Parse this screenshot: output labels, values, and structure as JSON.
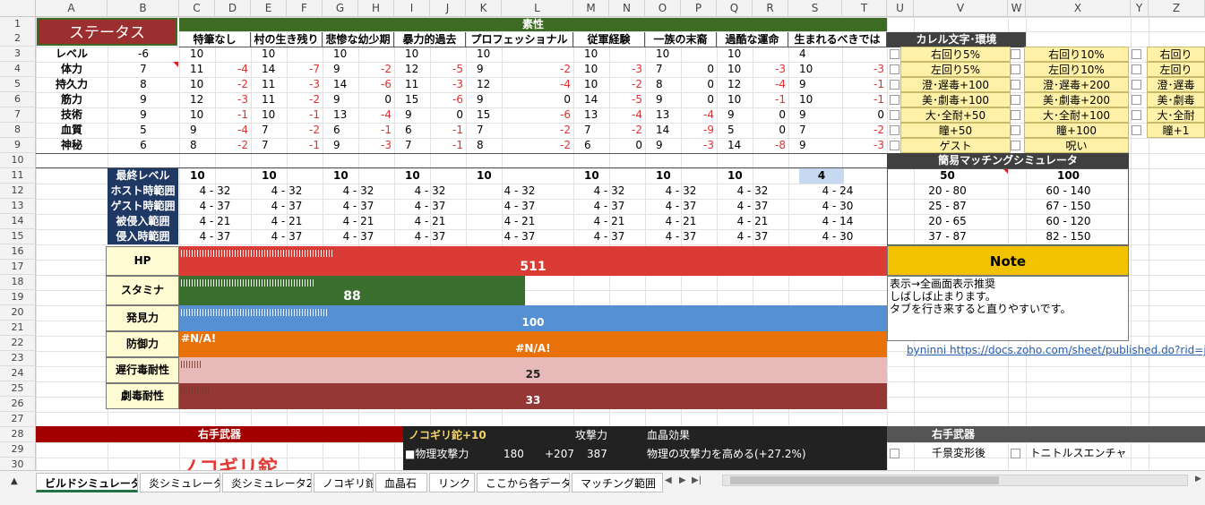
{
  "columns": [
    "A",
    "B",
    "C",
    "D",
    "E",
    "F",
    "G",
    "H",
    "I",
    "J",
    "K",
    "L",
    "M",
    "N",
    "O",
    "P",
    "Q",
    "R",
    "S",
    "T",
    "U",
    "V",
    "W",
    "X",
    "Y",
    "Z"
  ],
  "rows": [
    "1",
    "2",
    "3",
    "4",
    "5",
    "6",
    "7",
    "8",
    "9",
    "10",
    "11",
    "12",
    "13",
    "14",
    "15",
    "16",
    "17",
    "18",
    "19",
    "20",
    "21",
    "22",
    "23",
    "24",
    "25",
    "26",
    "27",
    "28",
    "29",
    "30"
  ],
  "status_title": "ステータス",
  "attr_header": "素性",
  "origins": [
    "特筆なし",
    "村の生き残り",
    "悲惨な幼少期",
    "暴力的過去",
    "プロフェッショナル",
    "従軍経験",
    "一族の末裔",
    "過酷な運命",
    "生まれるべきでは"
  ],
  "stats": [
    {
      "name": "レベル",
      "value": "-6",
      "cells": [
        [
          "10",
          ""
        ],
        [
          "10",
          ""
        ],
        [
          "10",
          ""
        ],
        [
          "10",
          ""
        ],
        [
          "10",
          ""
        ],
        [
          "10",
          ""
        ],
        [
          "10",
          ""
        ],
        [
          "10",
          ""
        ],
        [
          "4",
          ""
        ]
      ]
    },
    {
      "name": "体力",
      "value": "7",
      "cells": [
        [
          "11",
          "-4"
        ],
        [
          "14",
          "-7"
        ],
        [
          "9",
          "-2"
        ],
        [
          "12",
          "-5"
        ],
        [
          "9",
          "-2"
        ],
        [
          "10",
          "-3"
        ],
        [
          "7",
          "0"
        ],
        [
          "10",
          "-3"
        ],
        [
          "10",
          "-3"
        ]
      ]
    },
    {
      "name": "持久力",
      "value": "8",
      "cells": [
        [
          "10",
          "-2"
        ],
        [
          "11",
          "-3"
        ],
        [
          "14",
          "-6"
        ],
        [
          "11",
          "-3"
        ],
        [
          "12",
          "-4"
        ],
        [
          "10",
          "-2"
        ],
        [
          "8",
          "0"
        ],
        [
          "12",
          "-4"
        ],
        [
          "9",
          "-1"
        ]
      ]
    },
    {
      "name": "筋力",
      "value": "9",
      "cells": [
        [
          "12",
          "-3"
        ],
        [
          "11",
          "-2"
        ],
        [
          "9",
          "0"
        ],
        [
          "15",
          "-6"
        ],
        [
          "9",
          "0"
        ],
        [
          "14",
          "-5"
        ],
        [
          "9",
          "0"
        ],
        [
          "10",
          "-1"
        ],
        [
          "10",
          "-1"
        ]
      ]
    },
    {
      "name": "技術",
      "value": "9",
      "cells": [
        [
          "10",
          "-1"
        ],
        [
          "10",
          "-1"
        ],
        [
          "13",
          "-4"
        ],
        [
          "9",
          "0"
        ],
        [
          "15",
          "-6"
        ],
        [
          "13",
          "-4"
        ],
        [
          "13",
          "-4"
        ],
        [
          "9",
          "0"
        ],
        [
          "9",
          "0"
        ]
      ]
    },
    {
      "name": "血質",
      "value": "5",
      "cells": [
        [
          "9",
          "-4"
        ],
        [
          "7",
          "-2"
        ],
        [
          "6",
          "-1"
        ],
        [
          "6",
          "-1"
        ],
        [
          "7",
          "-2"
        ],
        [
          "7",
          "-2"
        ],
        [
          "14",
          "-9"
        ],
        [
          "5",
          "0"
        ],
        [
          "7",
          "-2"
        ]
      ]
    },
    {
      "name": "神秘",
      "value": "6",
      "cells": [
        [
          "8",
          "-2"
        ],
        [
          "7",
          "-1"
        ],
        [
          "9",
          "-3"
        ],
        [
          "7",
          "-1"
        ],
        [
          "8",
          "-2"
        ],
        [
          "6",
          "0"
        ],
        [
          "9",
          "-3"
        ],
        [
          "14",
          "-8"
        ],
        [
          "9",
          "-3"
        ]
      ]
    }
  ],
  "range_labels": [
    "最終レベル",
    "ホスト時範囲",
    "ゲスト時範囲",
    "被侵入範囲",
    "侵入時範囲"
  ],
  "final_levels": [
    "10",
    "10",
    "10",
    "10",
    "10",
    "10",
    "10",
    "10",
    "4"
  ],
  "ranges": [
    [
      "4 - 32",
      "4 - 32",
      "4 - 32",
      "4 - 32",
      "4 - 32",
      "4 - 32",
      "4 - 32",
      "4 - 32",
      "4 - 24"
    ],
    [
      "4 - 37",
      "4 - 37",
      "4 - 37",
      "4 - 37",
      "4 - 37",
      "4 - 37",
      "4 - 37",
      "4 - 37",
      "4 - 30"
    ],
    [
      "4 - 21",
      "4 - 21",
      "4 - 21",
      "4 - 21",
      "4 - 21",
      "4 - 21",
      "4 - 21",
      "4 - 21",
      "4 - 14"
    ],
    [
      "4 - 37",
      "4 - 37",
      "4 - 37",
      "4 - 37",
      "4 - 37",
      "4 - 37",
      "4 - 37",
      "4 - 37",
      "4 - 30"
    ]
  ],
  "bars": [
    {
      "label": "HP",
      "value": "511",
      "fill_fraction": 1.0,
      "color": "#da3b34"
    },
    {
      "label": "スタミナ",
      "value": "88",
      "fill_fraction": 0.488,
      "color": "#3a6e2f"
    },
    {
      "label": "発見力",
      "value": "100",
      "fill_fraction": 1.0,
      "color": "#5590d2"
    },
    {
      "label": "防御力",
      "value": "#N/A!",
      "fill_fraction": 1.0,
      "color": "#e8710a",
      "top_text": "#N/A!"
    },
    {
      "label": "遅行毒耐性",
      "value": "25",
      "fill_fraction": 1.0,
      "color": "#e7b9b9"
    },
    {
      "label": "劇毒耐性",
      "value": "33",
      "fill_fraction": 1.0,
      "color": "#953735"
    }
  ],
  "rune_header": "カレル文字･環境",
  "runes": [
    [
      "右回り5%",
      "右回り10%",
      "右回り"
    ],
    [
      "左回り5%",
      "左回り10%",
      "左回り"
    ],
    [
      "澄･遅毒+100",
      "澄･遅毒+200",
      "澄･遅毒"
    ],
    [
      "美･劇毒+100",
      "美･劇毒+200",
      "美･劇毒"
    ],
    [
      "大･全耐+50",
      "大･全耐+100",
      "大･全耐"
    ],
    [
      "瞳+50",
      "瞳+100",
      "瞳+1"
    ],
    [
      "ゲスト",
      "呪い",
      ""
    ]
  ],
  "matching_header": "簡易マッチングシミュレータ",
  "matching": [
    [
      "50",
      "100"
    ],
    [
      "20 - 80",
      "60 - 140"
    ],
    [
      "25 - 87",
      "67 - 150"
    ],
    [
      "20 - 65",
      "60 - 120"
    ],
    [
      "37 - 87",
      "82 - 150"
    ]
  ],
  "note_title": "Note",
  "note_lines": [
    "表示→全画面表示推奨",
    "しばしば止まります。",
    "タブを行き来すると直りやすいです。"
  ],
  "link_text": "byninni   https://docs.zoho.com/sheet/published.do?rid=jfr",
  "weapon_header": "右手武器",
  "weapon_name": "ノコギリ鉈+10",
  "weapon_big": "ノコギリ鉈",
  "attack_label": "攻撃力",
  "gem_label": "血晶効果",
  "phys_label": "■物理攻撃力",
  "phys_values": [
    "180",
    "+207",
    "387"
  ],
  "gem_effect": "物理の攻撃力を高める(+27.2%)",
  "row31_label": "…",
  "right_weapon_header": "右手武器",
  "right_weapon_items": [
    "千景変形後",
    "トニトルスエンチャ"
  ],
  "sheet_tabs": [
    "ビルドシミュレータ",
    "炎シミュレータ",
    "炎シミュレータ2",
    "ノコギリ鉈",
    "血晶石",
    "リンク",
    "ここから各データ",
    "マッチング範囲"
  ],
  "active_tab": "ビルドシミュレータ",
  "colors": {
    "title_red": "#9b2e2e",
    "attr_green": "#3d6b24",
    "range_blue": "#1f3864",
    "dark_header": "#404040",
    "note_yellow": "#f2c100",
    "weapon_red": "#a30000"
  }
}
